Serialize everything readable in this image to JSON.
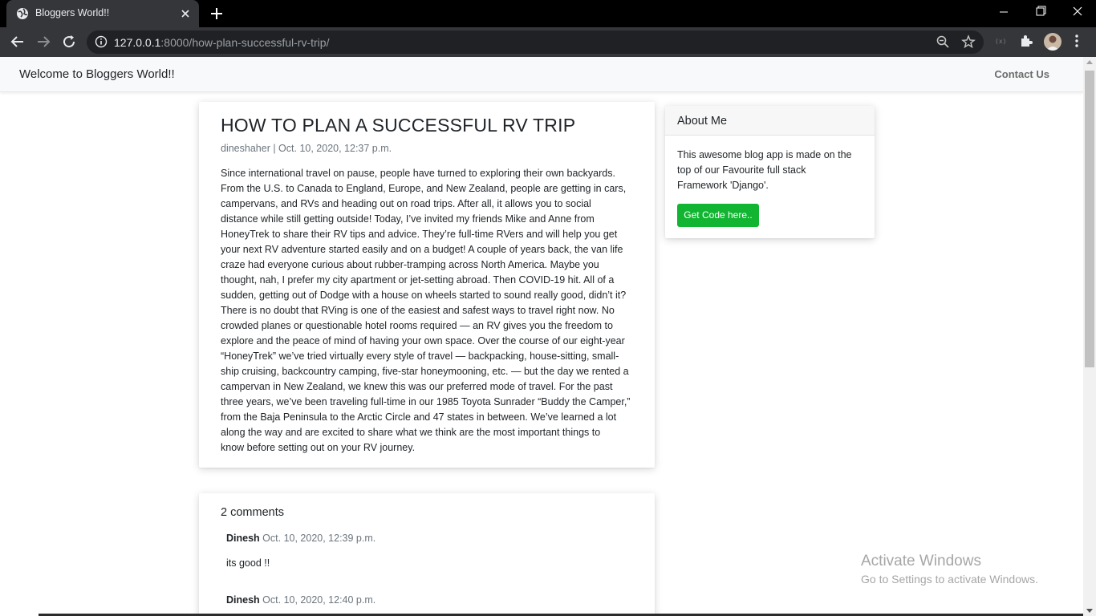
{
  "browser": {
    "tab_title": "Bloggers World!!",
    "url_host": "127.0.0.1",
    "url_rest": ":8000/how-plan-successful-rv-trip/"
  },
  "navbar": {
    "brand": "Welcome to Bloggers World!!",
    "contact": "Contact Us"
  },
  "post": {
    "title": "HOW TO PLAN A SUCCESSFUL RV TRIP",
    "meta": "dineshaher | Oct. 10, 2020, 12:37 p.m.",
    "body_lines": [
      "Since international travel on pause, people have turned to exploring their own backyards.",
      "From the U.S. to Canada to England, Europe, and New Zealand, people are getting in cars,",
      "campervans, and RVs and heading out on road trips. After all, it allows you to social",
      "distance while still getting outside! Today, I’ve invited my friends Mike and Anne from",
      "HoneyTrek to share their RV tips and advice. They’re full-time RVers and will help you get",
      "your next RV adventure started easily and on a budget! A couple of years back, the van life",
      "craze had everyone curious about rubber-tramping across North America. Maybe you",
      "thought, nah, I prefer my city apartment or jet-setting abroad. Then COVID-19 hit. All of a",
      "sudden, getting out of Dodge with a house on wheels started to sound really good, didn’t it?",
      "There is no doubt that RVing is one of the easiest and safest ways to travel right now. No",
      "crowded planes or questionable hotel rooms required — an RV gives you the freedom to",
      "explore and the peace of mind of having your own space. Over the course of our eight-year",
      "“HoneyTrek” we’ve tried virtually every style of travel — backpacking, house-sitting, small-",
      "ship cruising, backcountry camping, five-star honeymooning, etc. — but the day we rented a",
      "campervan in New Zealand, we knew this was our preferred mode of travel. For the past",
      "three years, we’ve been traveling full-time in our 1985 Toyota Sunrader “Buddy the Camper,”",
      "from the Baja Peninsula to the Arctic Circle and 47 states in between. We’ve learned a lot",
      "along the way and are excited to share what we think are the most important things to",
      "know before setting out on your RV journey."
    ]
  },
  "about": {
    "title": "About Me",
    "text_lines": [
      "This awesome blog app is made on the",
      "top of our Favourite full stack",
      "Framework 'Django'."
    ],
    "button": "Get Code here.."
  },
  "comments": {
    "title": "2 comments",
    "items": [
      {
        "author": "Dinesh",
        "date": "Oct. 10, 2020, 12:39 p.m.",
        "text": "its good !!"
      },
      {
        "author": "Dinesh",
        "date": "Oct. 10, 2020, 12:40 p.m.",
        "text": ""
      }
    ]
  },
  "watermark": {
    "title": "Activate Windows",
    "subtitle": "Go to Settings to activate Windows."
  }
}
